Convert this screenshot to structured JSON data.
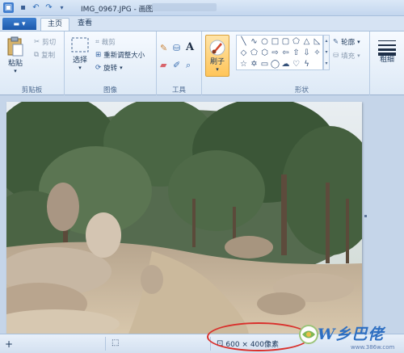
{
  "window": {
    "title": "IMG_0967.JPG - 画图",
    "title_suffix_blur": ""
  },
  "tabs": {
    "app_menu": "▾",
    "home": "主页",
    "view": "查看"
  },
  "groups": {
    "clipboard": {
      "label": "剪贴板",
      "paste": "粘贴",
      "cut": "剪切",
      "copy": "复制"
    },
    "image": {
      "label": "图像",
      "select": "选择",
      "crop": "裁剪",
      "resize": "重新调整大小",
      "rotate": "旋转"
    },
    "tools": {
      "label": "工具"
    },
    "brushes": {
      "label": "刷子"
    },
    "shapes": {
      "label": "形状",
      "outline": "轮廓",
      "fill": "填充"
    },
    "size": {
      "label": "粗细"
    }
  },
  "statusbar": {
    "dimensions": "600 × 400像素"
  },
  "watermark": {
    "brand": "W乡巴佬",
    "url": "www.386w.com"
  },
  "colors": {
    "accent": "#1b58ab",
    "annotation": "#d9302c",
    "watermark": "#2e6fc2"
  }
}
